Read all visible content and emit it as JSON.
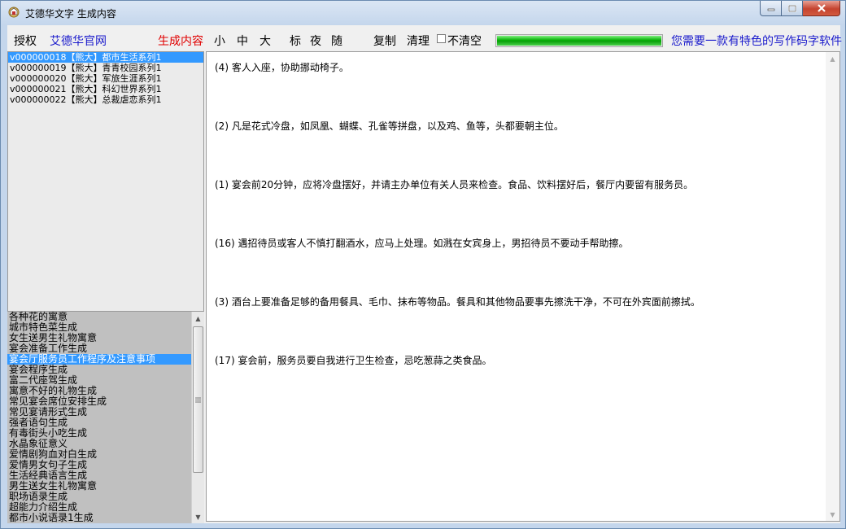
{
  "window": {
    "title": "艾德华文字 生成内容",
    "icon": "app-icon",
    "controls": [
      "minimize-icon",
      "maximize-icon",
      "close-icon"
    ]
  },
  "toolbar": {
    "authorize": "授权",
    "website": "艾德华官网",
    "generate": "生成内容",
    "size_small": "小",
    "size_medium": "中",
    "size_large": "大",
    "mode_standard": "标",
    "mode_night": "夜",
    "mode_random": "随",
    "copy": "复制",
    "clear": "清理",
    "no_clear": "不清空",
    "no_clear_checked": false,
    "progress": 1.0,
    "slogan": "您需要一款有特色的写作码字软件"
  },
  "series_list": [
    "v000000018【熊大】都市生活系列1",
    "v000000019【熊大】青青校园系列1",
    "v000000020【熊大】军旅生涯系列1",
    "v000000021【熊大】科幻世界系列1",
    "v000000022【熊大】总裁虐恋系列1"
  ],
  "series_selected_index": 0,
  "topics": [
    "各种花的寓意",
    "城市特色菜生成",
    "女生送男生礼物寓意",
    "宴会准备工作生成",
    "宴会厅服务员工作程序及注意事项",
    "宴会程序生成",
    "富二代座驾生成",
    "寓意不好的礼物生成",
    "常见宴会席位安排生成",
    "常见宴请形式生成",
    "强者语句生成",
    "有毒街头小吃生成",
    "水晶象征意义",
    "爱情剧狗血对白生成",
    "爱情男女句子生成",
    "生活经典语言生成",
    "男生送女生礼物寓意",
    "职场语录生成",
    "超能力介绍生成",
    "都市小说语录1生成"
  ],
  "topics_selected_index": 4,
  "content_paragraphs": [
    "(4) 客人入座，协助挪动椅子。",
    "(2) 凡是花式冷盘，如凤凰、蝴蝶、孔雀等拼盘，以及鸡、鱼等，头都要朝主位。",
    "(1) 宴会前20分钟，应将冷盘摆好，并请主办单位有关人员来检查。食品、饮料摆好后，餐厅内要留有服务员。",
    "(16) 遇招待员或客人不慎打翻酒水，应马上处理。如溅在女宾身上，男招待员不要动手帮助擦。",
    "(3) 酒台上要准备足够的备用餐具、毛巾、抹布等物品。餐具和其他物品要事先擦洗干净，不可在外宾面前擦拭。",
    "(17) 宴会前，服务员要自我进行卫生检查，忌吃葱蒜之类食品。"
  ]
}
